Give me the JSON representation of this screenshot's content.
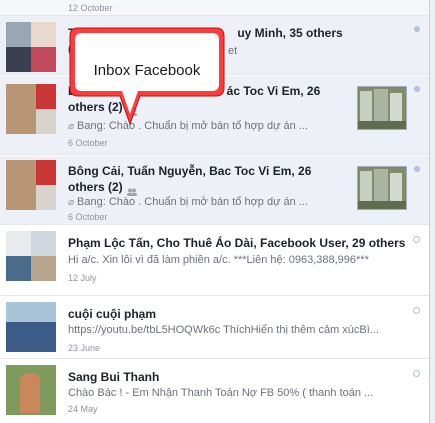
{
  "top_date": "12 October",
  "callout_text": "Inbox Facebook",
  "threads": [
    {
      "title": "Tuấn Nguyễn, Bac Toc Vi Em, Huy Minh, 35 others (14)",
      "title_visible_start": "T",
      "title_visible_end": "uy Minh, 35 others (14)",
      "snippet_visible_end": "et",
      "date": ""
    },
    {
      "title_visible_start": "B",
      "title_line1_end": "ác Toc Vi Em, 26",
      "title_line2": "others (2)",
      "snippet": "Bang: Chào . Chuẩn bị mở bán tổ hợp dự án ...",
      "date": "6 October"
    },
    {
      "title_line1": "Bông Cải, Tuấn Nguyễn, Bac Toc Vi Em, 26",
      "title_line2": "others (2)",
      "snippet": "Bang: Chào . Chuẩn bị mở bán tổ hợp dự án ...",
      "date": "6 October"
    },
    {
      "title": "Phạm Lộc Tấn, Cho Thuê Áo Dài, Facebook User, 29 others",
      "snippet": "Hi a/c. Xin lỗi vì đã làm phiền a/c. ***Liên hệ: 0963,388,996***",
      "date": "12 July"
    },
    {
      "title": "cuội cuội phạm",
      "snippet": "https://youtu.be/tbL5HOQWk6c ThíchHiển thị thêm cảm xúcBì...",
      "date": "23 June"
    },
    {
      "title": "Sang Bui Thanh",
      "snippet": "Chào Bác ! - Em Nhận Thanh Toán Nợ FB 50% ( thanh toán ...",
      "date": "24 May"
    }
  ],
  "colors": {
    "unread_bg": "#edf0f6",
    "callout_fill": "#ff3b3b",
    "callout_inner": "#ffffff",
    "dot": "#b5bfd6"
  },
  "icons": [
    "group-icon",
    "unread-dot-icon",
    "attachment-icon",
    "read-circle-icon"
  ]
}
